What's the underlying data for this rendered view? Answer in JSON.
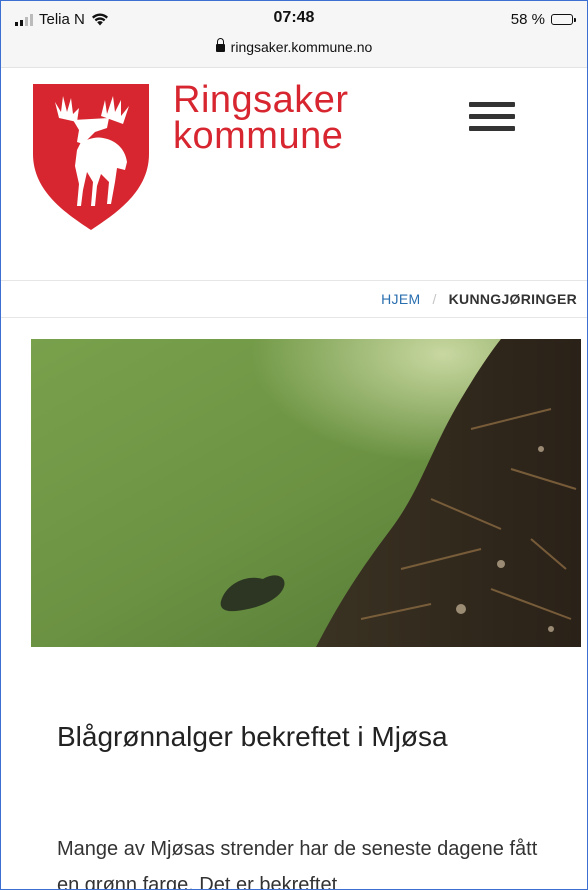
{
  "status_bar": {
    "carrier": "Telia N",
    "time": "07:48",
    "url": "ringsaker.kommune.no",
    "battery": "58 %",
    "battery_level": 0.58
  },
  "header": {
    "brand_line1": "Ringsaker",
    "brand_line2": "kommune",
    "logo_icon": "moose-shield-icon",
    "menu_icon": "hamburger-menu-icon"
  },
  "breadcrumb": {
    "home": "HJEM",
    "separator": "/",
    "current": "KUNNGJØRINGER"
  },
  "article": {
    "title": "Blågrønnalger bekreftet i Mjøsa",
    "lead": "Mange av Mjøsas strender har de seneste dagene fått en grønn farge. Det er bekreftet"
  },
  "colors": {
    "brand_red": "#d7262f",
    "link_blue": "#2a6fb0",
    "water_green": "#6e9440",
    "frame_border": "#3b6fd1"
  }
}
